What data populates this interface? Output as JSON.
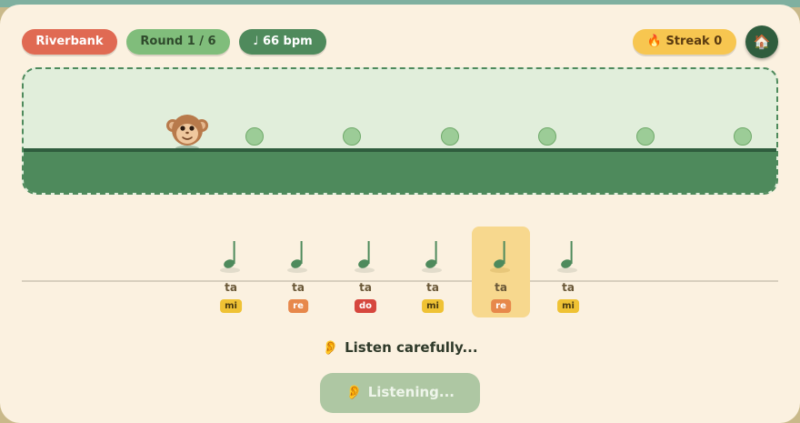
{
  "header": {
    "level_label": "Riverbank",
    "round_label": "Round 1 / 6",
    "tempo_label": "♩ 66 bpm",
    "streak_label": "🔥 Streak 0",
    "home_icon": "🏠"
  },
  "stage": {
    "stones": 6
  },
  "beats": [
    {
      "syllable": "ta",
      "solfa": "mi",
      "active": false
    },
    {
      "syllable": "ta",
      "solfa": "re",
      "active": false
    },
    {
      "syllable": "ta",
      "solfa": "do",
      "active": false
    },
    {
      "syllable": "ta",
      "solfa": "mi",
      "active": false
    },
    {
      "syllable": "ta",
      "solfa": "re",
      "active": true
    },
    {
      "syllable": "ta",
      "solfa": "mi",
      "active": false
    }
  ],
  "status": {
    "icon": "👂",
    "text": "Listen carefully..."
  },
  "listen_button": {
    "icon": "👂",
    "label": "Listening..."
  },
  "colors": {
    "accent_green": "#4e8a5c",
    "dark_green": "#2f5d3e",
    "level_red": "#e06a53",
    "streak_yellow": "#f7c650",
    "background": "#fbf1e0"
  }
}
